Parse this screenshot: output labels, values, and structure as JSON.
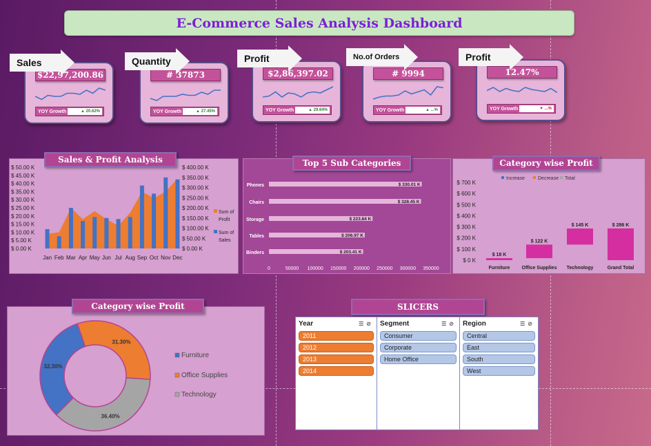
{
  "title": "E-Commerce Sales Analysis Dashboard",
  "kpis": [
    {
      "label": "Sales",
      "value": "$22,97,200.86",
      "yoy_label": "YOY Growth",
      "yoy_value": "20.62%",
      "trend": "up",
      "spark": [
        0.6,
        0.75,
        0.55,
        0.6,
        0.6,
        0.45,
        0.45,
        0.5,
        0.3,
        0.45,
        0.2,
        0.3
      ]
    },
    {
      "label": "Quantity",
      "value": "# 37873",
      "yoy_label": "YOY Growth",
      "yoy_value": "27.45%",
      "trend": "up",
      "spark": [
        0.7,
        0.8,
        0.6,
        0.6,
        0.6,
        0.5,
        0.55,
        0.55,
        0.4,
        0.5,
        0.3,
        0.3
      ]
    },
    {
      "label": "Profit",
      "value": "$2,86,397.02",
      "yoy_label": "YOY Growth",
      "yoy_value": "29.64%",
      "trend": "up",
      "spark": [
        0.7,
        0.65,
        0.45,
        0.7,
        0.5,
        0.55,
        0.7,
        0.5,
        0.45,
        0.5,
        0.35,
        0.2
      ]
    },
    {
      "label": "No.of Orders",
      "value": "# 9994",
      "yoy_label": "YOY Growth",
      "yoy_value": "...%",
      "trend": "up",
      "spark": [
        0.8,
        0.7,
        0.65,
        0.65,
        0.6,
        0.4,
        0.55,
        0.45,
        0.35,
        0.6,
        0.2,
        0.25
      ]
    },
    {
      "label": "Profit",
      "value": "12.47%",
      "yoy_label": "YOY Growth",
      "yoy_value": "...%",
      "trend": "down",
      "spark": [
        0.45,
        0.3,
        0.5,
        0.35,
        0.45,
        0.5,
        0.3,
        0.4,
        0.45,
        0.5,
        0.35,
        0.55
      ]
    }
  ],
  "sales_profit": {
    "title": "Sales & Profit Analysis",
    "left_ticks": [
      "$ 50.00 K",
      "$ 45.00 K",
      "$ 40.00 K",
      "$ 35.00 K",
      "$ 30.00 K",
      "$ 25.00 K",
      "$ 20.00 K",
      "$ 15.00 K",
      "$ 10.00 K",
      "$ 5.00 K",
      "$ 0.00 K"
    ],
    "right_ticks": [
      "$ 400.00 K",
      "$ 350.00 K",
      "$ 300.00 K",
      "$ 250.00 K",
      "$ 200.00 K",
      "$ 150.00 K",
      "$ 100.00 K",
      "$ 50.00 K",
      "$ 0.00 K"
    ],
    "legend_profit": "Sum of Profit",
    "legend_sales": "Sum of Sales",
    "profit_color": "#ed7d31",
    "sales_color": "#4472c4"
  },
  "top5": {
    "title": "Top 5 Sub Categories",
    "x_ticks": [
      "0",
      "50000",
      "100000",
      "150000",
      "200000",
      "250000",
      "300000",
      "350000"
    ]
  },
  "category_waterfall": {
    "title": "Category wise Profit",
    "legend": [
      "Increase",
      "Decrease",
      "Total"
    ],
    "legend_colors": [
      "#4472c4",
      "#ed7d31",
      "#a5a5a5"
    ],
    "y_ticks": [
      "$ 700 K",
      "$ 600 K",
      "$ 500 K",
      "$ 400 K",
      "$ 300 K",
      "$ 200 K",
      "$ 100 K",
      "$ 0 K"
    ]
  },
  "category_donut": {
    "title": "Category wise Profit"
  },
  "slicers": {
    "title": "SLICERS",
    "year": {
      "header": "Year",
      "items": [
        "2011",
        "2012",
        "2013",
        "2014"
      ]
    },
    "segment": {
      "header": "Segment",
      "items": [
        "Consumer",
        "Corporate",
        "Home Office"
      ]
    },
    "region": {
      "header": "Region",
      "items": [
        "Central",
        "East",
        "South",
        "West"
      ]
    }
  },
  "chart_data": [
    {
      "type": "bar",
      "title": "Sales & Profit Analysis",
      "categories": [
        "Jan",
        "Feb",
        "Mar",
        "Apr",
        "May",
        "Jun",
        "Jul",
        "Aug",
        "Sep",
        "Oct",
        "Nov",
        "Dec"
      ],
      "series": [
        {
          "name": "Sum of Profit",
          "kind": "area",
          "axis": "left",
          "values": [
            9000,
            10000,
            25000,
            18000,
            23000,
            18000,
            14000,
            22000,
            35000,
            31000,
            35000,
            43000
          ]
        },
        {
          "name": "Sum of Sales",
          "kind": "bar",
          "axis": "right",
          "values": [
            95000,
            60000,
            200000,
            135000,
            155000,
            150000,
            145000,
            155000,
            310000,
            270000,
            350000,
            340000
          ]
        }
      ],
      "ylim_left": [
        0,
        50000
      ],
      "ylim_right": [
        0,
        400000
      ]
    },
    {
      "type": "bar",
      "title": "Top 5 Sub Categories",
      "orientation": "horizontal",
      "categories": [
        "Phones",
        "Chairs",
        "Storage",
        "Tables",
        "Binders"
      ],
      "values": [
        330010,
        328450,
        223840,
        206970,
        203410
      ],
      "labels": [
        "$ 330.01 K",
        "$ 328.45 K",
        "$ 223.84 K",
        "$ 206.97 K",
        "$ 203.41 K"
      ],
      "xlim": [
        0,
        350000
      ]
    },
    {
      "type": "bar",
      "title": "Category wise Profit",
      "kind": "waterfall",
      "categories": [
        "Furniture",
        "Office Supplies",
        "Technology",
        "Grand Total"
      ],
      "values": [
        18,
        122,
        145,
        286
      ],
      "labels": [
        "$ 18 K",
        "$ 122 K",
        "$ 145 K",
        "$ 286 K"
      ],
      "ylim": [
        0,
        700
      ]
    },
    {
      "type": "pie",
      "title": "Category wise Profit",
      "donut": true,
      "categories": [
        "Furniture",
        "Office Supplies",
        "Technology"
      ],
      "values": [
        32.3,
        31.3,
        36.4
      ],
      "labels": [
        "32.30%",
        "31.30%",
        "36.40%"
      ],
      "colors": [
        "#4472c4",
        "#ed7d31",
        "#a5a5a5"
      ]
    }
  ]
}
